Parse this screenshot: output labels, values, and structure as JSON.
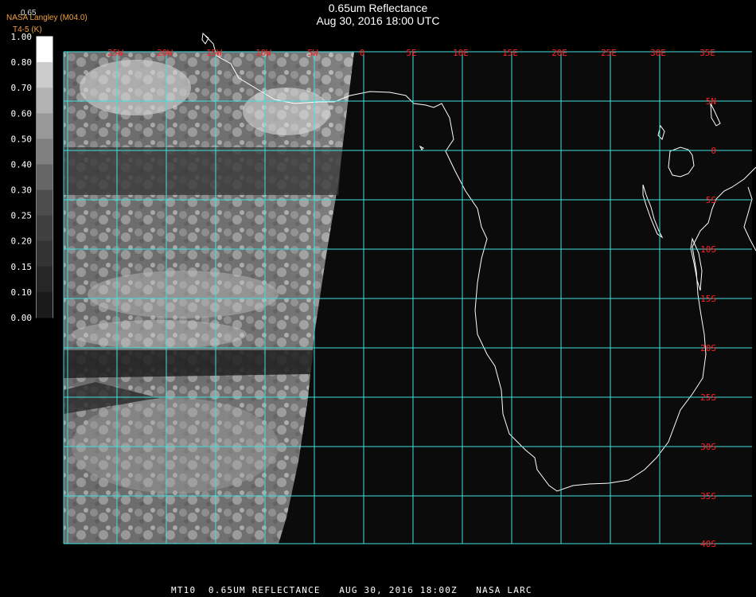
{
  "title": {
    "line1": "0.65um Reflectance",
    "line2": "Aug 30, 2016 18:00 UTC"
  },
  "header_labels": {
    "producer": "NASA Langley (M04.0)",
    "channel": "T4-5 (K)",
    "band_value": "0.65"
  },
  "colorbar": {
    "ticks": [
      "1.00",
      "0.80",
      "0.70",
      "0.60",
      "0.50",
      "0.40",
      "0.30",
      "0.25",
      "0.20",
      "0.15",
      "0.10",
      "0.00"
    ]
  },
  "map": {
    "lon_labels": [
      "25W",
      "20W",
      "15W",
      "10W",
      "5W",
      "0",
      "5E",
      "10E",
      "15E",
      "20E",
      "25E",
      "30E",
      "35E"
    ],
    "lat_labels": [
      "5N",
      "0",
      "5S",
      "10S",
      "15S",
      "20S",
      "25S",
      "30S",
      "35S",
      "40S"
    ],
    "colors": {
      "grid": "#40e0e0",
      "grid_label": "#ff2020",
      "coast": "#ffffff",
      "background": "#0a0a0a"
    }
  },
  "footer": "MT10  0.65UM REFLECTANCE   AUG 30, 2016 18:00Z   NASA LARC"
}
